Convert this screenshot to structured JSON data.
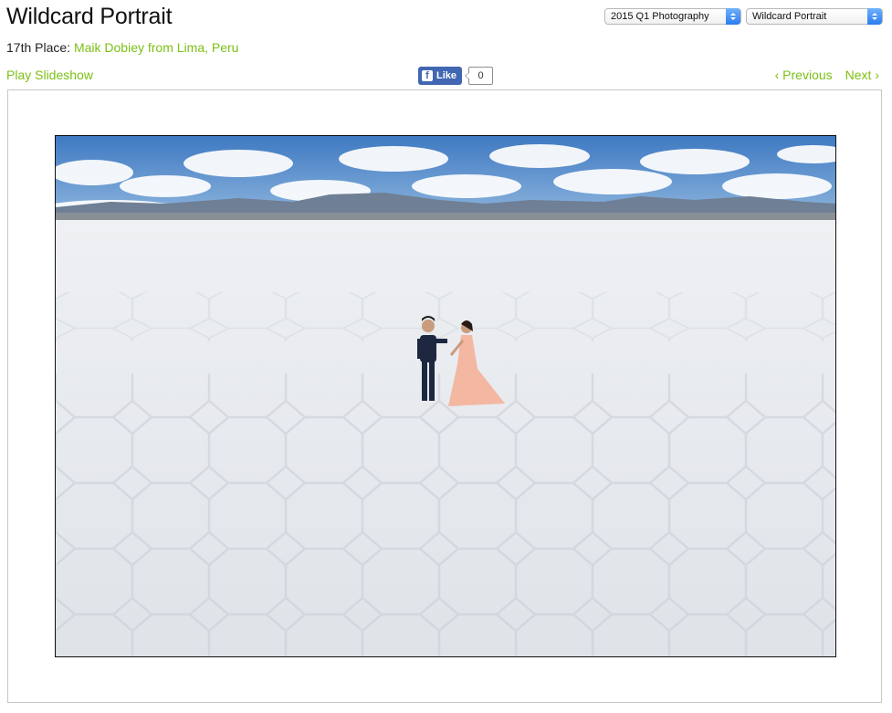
{
  "header": {
    "title": "Wildcard Portrait",
    "place_prefix": "17th Place:",
    "place_link": "Maik Dobiey from Lima, Peru"
  },
  "selects": {
    "contest": "2015 Q1 Photography",
    "category": "Wildcard Portrait"
  },
  "toolbar": {
    "slideshow": "Play Slideshow",
    "like_label": "Like",
    "like_count": "0",
    "previous": "‹ Previous",
    "next": "Next ›"
  },
  "colors": {
    "link": "#7cc016",
    "facebook": "#4267b2",
    "select_arrow": "#2b7cf0"
  },
  "icons": {
    "facebook": "facebook-f-icon",
    "select_arrows": "up-down-chevron-icon"
  }
}
